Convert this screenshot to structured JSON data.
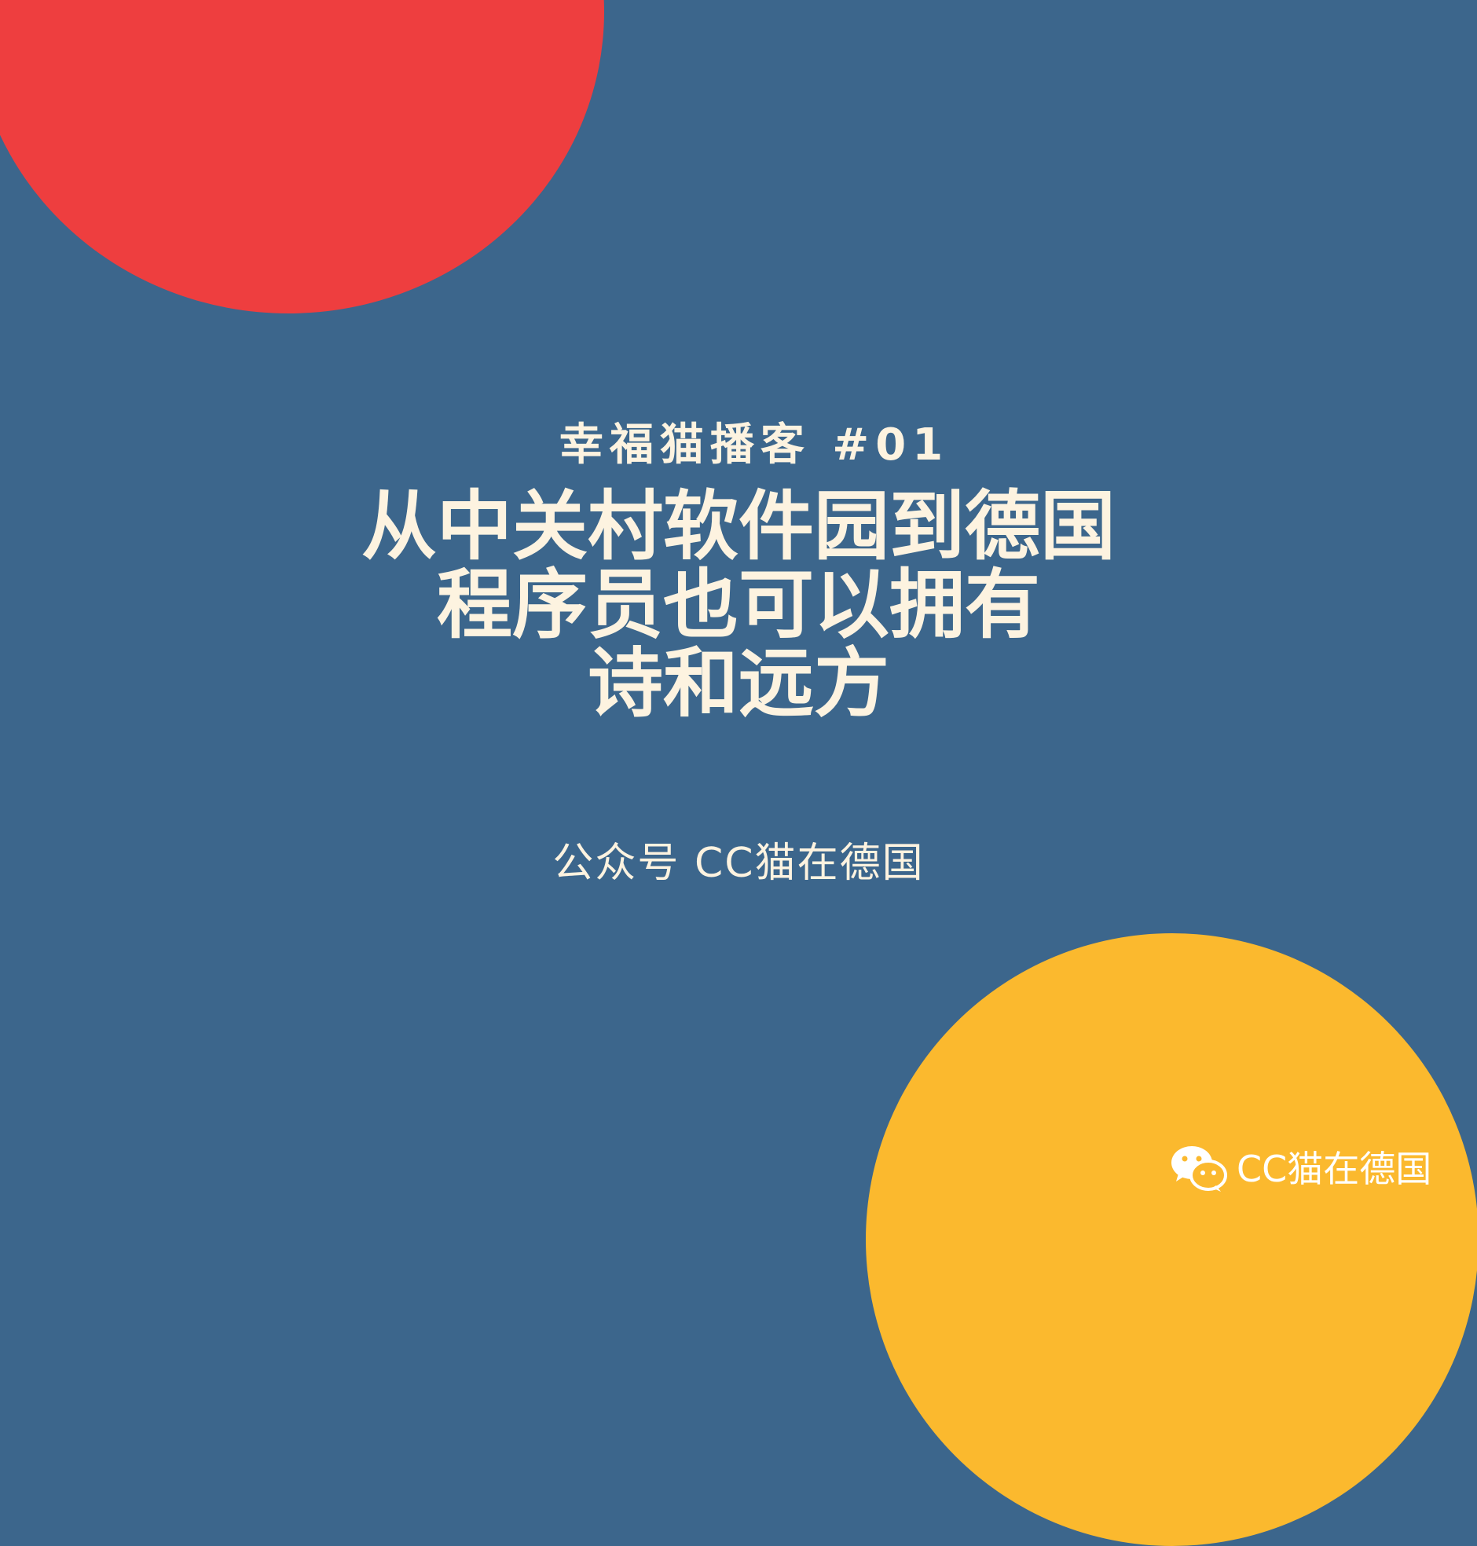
{
  "colors": {
    "background": "#3c668c",
    "red_circle": "#ee3e3f",
    "yellow_circle": "#fbb92e",
    "text": "#fdf3e0"
  },
  "subtitle": "幸福猫播客 #01",
  "title_lines": [
    "从中关村软件园到德国",
    "程序员也可以拥有",
    "诗和远方"
  ],
  "account": "公众号 CC猫在德国",
  "watermark": {
    "icon": "wechat-icon",
    "text": "CC猫在德国"
  }
}
